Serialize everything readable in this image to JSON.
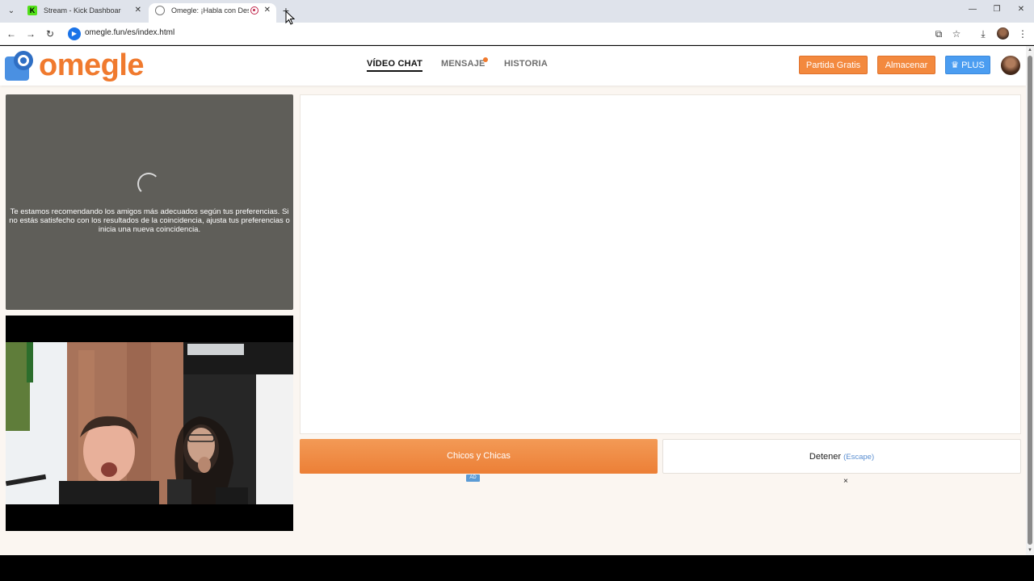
{
  "browser": {
    "tabs": [
      {
        "title": "Stream - Kick Dashboard",
        "icon": "kick-icon"
      },
      {
        "title": "Omegle: ¡Habla con Descon",
        "icon": "globe-icon",
        "active": true
      }
    ],
    "url": "omegle.fun/es/index.html"
  },
  "site": {
    "logo_text": "omegle",
    "nav": [
      {
        "label": "VÍDEO CHAT",
        "active": true
      },
      {
        "label": "MENSAJE",
        "badge": true
      },
      {
        "label": "HISTORIA"
      }
    ],
    "buttons": {
      "free_match": "Partida Gratis",
      "store": "Almacenar",
      "plus": "PLUS"
    }
  },
  "stranger_panel": {
    "message": "Te estamos recomendando los amigos más adecuados según tus preferencias. Si no estás satisfecho con los resultados de la coincidencia, ajusta tus preferencias o inicia una nueva coincidencia."
  },
  "actions": {
    "start_label": "Chicos y Chicas",
    "stop_label": "Detener",
    "stop_hint": "(Escape)",
    "ad_label": "AD",
    "close_symbol": "×"
  },
  "colors": {
    "brand_orange": "#f07a2e",
    "plus_blue": "#4b9df1",
    "page_bg": "#fbf6f1"
  }
}
